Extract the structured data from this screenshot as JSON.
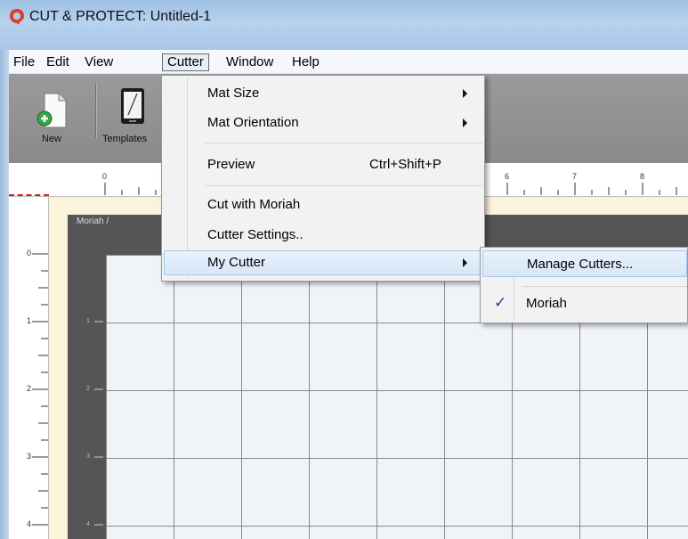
{
  "window": {
    "title": "CUT & PROTECT: Untitled-1"
  },
  "menubar": {
    "items": [
      "File",
      "Edit",
      "View",
      "Cutter",
      "Window",
      "Help"
    ],
    "active": "Cutter"
  },
  "toolbar": {
    "new_label": "New",
    "templates_label": "Templates"
  },
  "cutter_menu": {
    "mat_size": "Mat Size",
    "mat_orientation": "Mat Orientation",
    "preview": "Preview",
    "preview_shortcut": "Ctrl+Shift+P",
    "cut_with": "Cut with Moriah",
    "cutter_settings": "Cutter Settings..",
    "my_cutter": "My Cutter"
  },
  "my_cutter_submenu": {
    "manage": "Manage Cutters...",
    "selected_cutter": "Moriah",
    "check_glyph": "✓"
  },
  "canvas": {
    "mat_label": "Moriah /",
    "h_ruler": [
      "0",
      "6",
      "7",
      "8"
    ],
    "v_ruler": [
      "0",
      "1",
      "2",
      "3",
      "4"
    ],
    "inner_v_ruler": [
      "1",
      "2",
      "3",
      "4"
    ]
  },
  "colors": {
    "highlight": "#d6e6f8",
    "check": "#1a3d8f",
    "logo": "#d8402a"
  }
}
